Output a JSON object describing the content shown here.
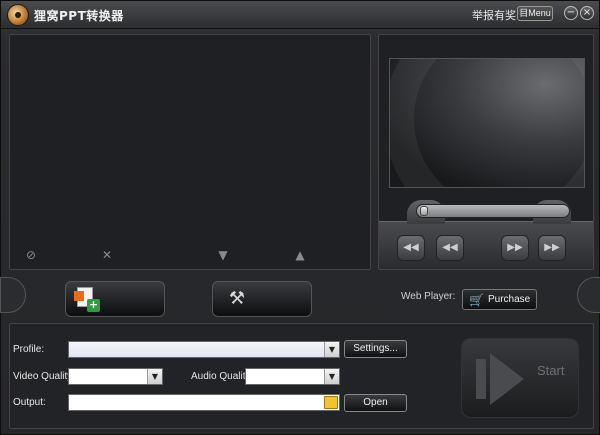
{
  "titlebar": {
    "title": "狸窝PPT转换器",
    "report": "举报有奖",
    "menu_label": "目Menu",
    "minimize_glyph": "−",
    "close_glyph": "×"
  },
  "file_panel": {
    "icons": [
      "clear-icon",
      "delete-icon",
      "move-down-icon",
      "move-up-icon"
    ],
    "glyphs": [
      "⊘",
      "✕",
      "▼",
      "▲"
    ]
  },
  "preview": {
    "controls": [
      "previous-icon",
      "rewind-icon",
      "fast-forward-icon",
      "next-icon"
    ],
    "glyphs": [
      "◀◀",
      "◀◀",
      "▶▶",
      "▶▶"
    ],
    "seek_progress": 0.0
  },
  "actions": {
    "web_player_label": "Web Player:",
    "purchase_label": "Purchase"
  },
  "settings": {
    "profile_label": "Profile:",
    "profile_value": "",
    "settings_button": "Settings...",
    "video_quality_label": "Video Quality:",
    "video_quality_value": "",
    "audio_quality_label": "Audio Quality:",
    "audio_quality_value": "",
    "output_label": "Output:",
    "output_value": "",
    "open_button": "Open",
    "start_label": "Start"
  },
  "colors": {
    "background": "#252629",
    "panel": "#1f2023",
    "accent_orange": "#e86b1f",
    "accent_green": "#2e9c3f"
  }
}
